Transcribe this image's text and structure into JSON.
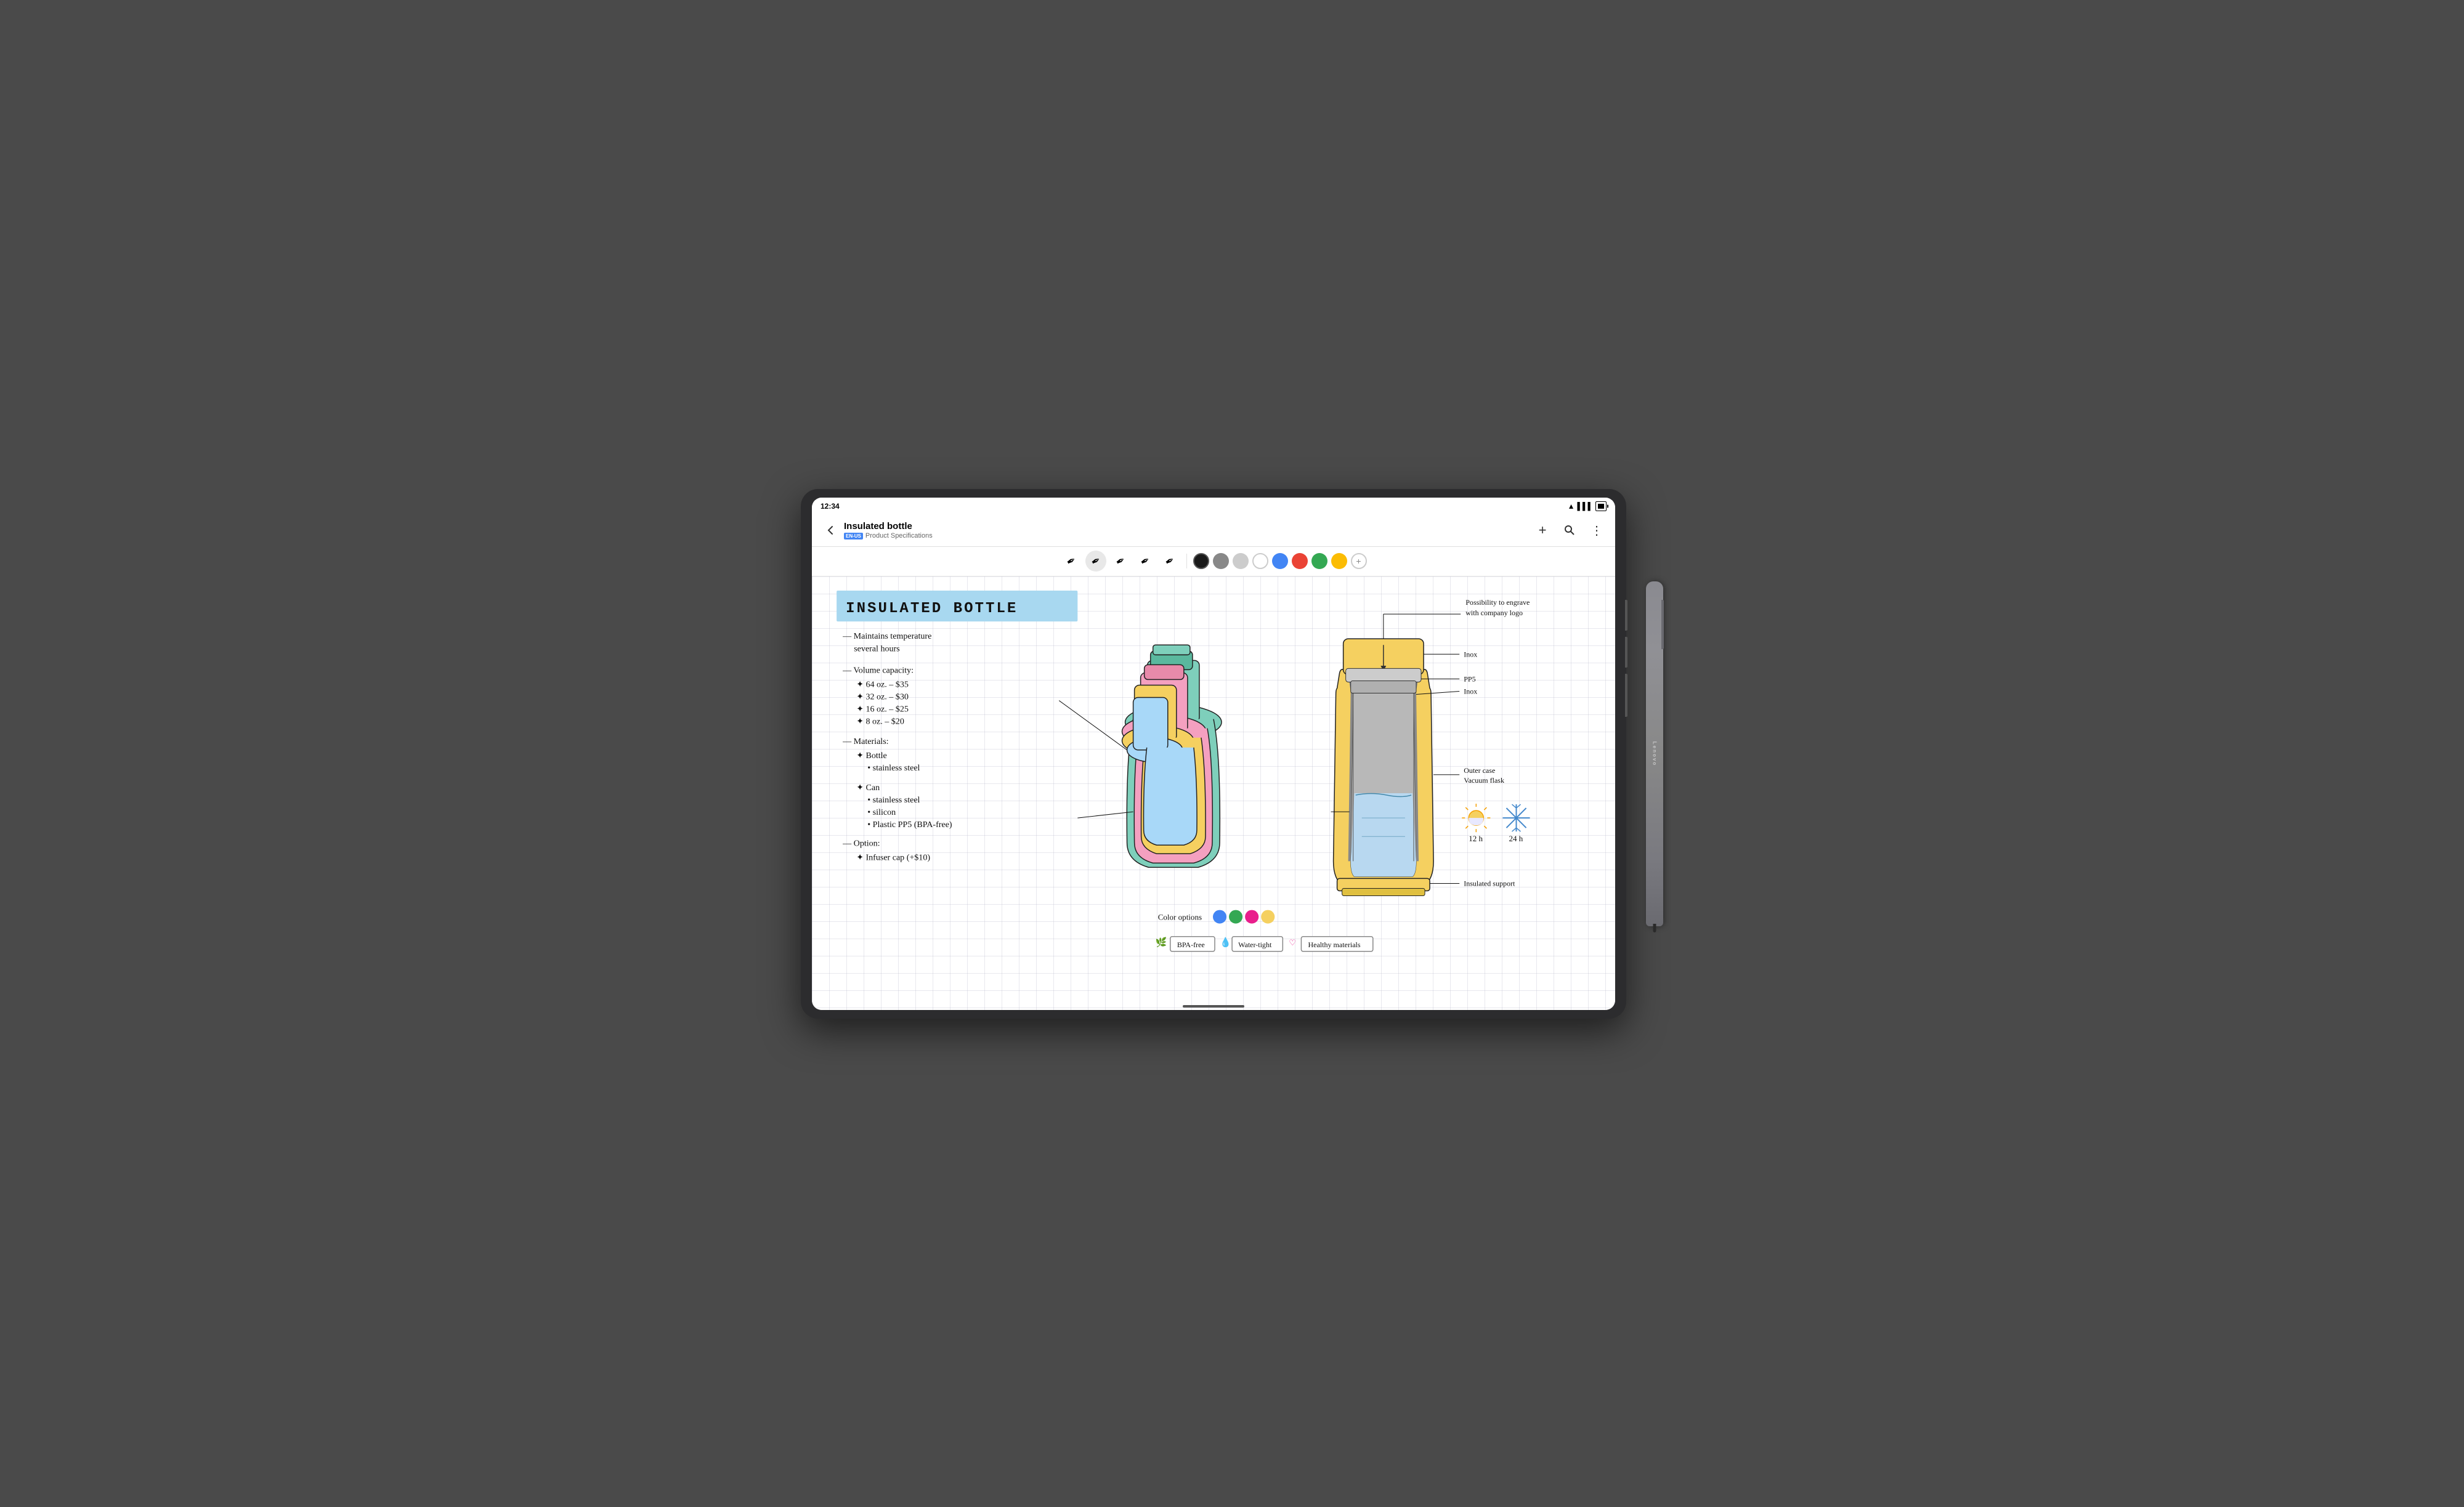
{
  "device": {
    "time": "12:34",
    "brand": "Lenovo"
  },
  "app_bar": {
    "title": "Insulated bottle",
    "lang_badge": "EN-US",
    "subtitle": "Product Specifications",
    "back_label": "←",
    "add_label": "+",
    "search_label": "🔍",
    "more_label": "⋮"
  },
  "toolbar": {
    "pen_tools": [
      "✒",
      "✒",
      "✒",
      "✒",
      "✒"
    ],
    "colors": [
      {
        "color": "#1a1a1a",
        "selected": true
      },
      {
        "color": "#888888",
        "selected": false
      },
      {
        "color": "#cccccc",
        "selected": false
      },
      {
        "color": "#ffffff",
        "selected": false
      },
      {
        "color": "#4285f4",
        "selected": false
      },
      {
        "color": "#ea4335",
        "selected": false
      },
      {
        "color": "#34a853",
        "selected": false
      },
      {
        "color": "#fbbc04",
        "selected": false
      }
    ],
    "add_color": "+"
  },
  "note": {
    "title": "INSULATED BOTTLE",
    "lines": [
      "— Maintains temperature",
      "   several hours",
      "",
      "— Volume capacity:",
      "  ✦ 64 oz. – $35",
      "  ✦ 32 oz. – $30",
      "  ✦ 16 oz. – $25",
      "  ✦ 8 oz. – $20",
      "",
      "— Materials:",
      "  ✦ Bottle",
      "    • stainless steel",
      "",
      "  ✦ Can",
      "    • stainless steel",
      "    • silicon",
      "    • Plastic PP5 (BPA-free)",
      "",
      "— Option:",
      "  ✦ Infuser cap (+$10)"
    ]
  },
  "diagram": {
    "labels": [
      "Possibility to engrave",
      "with company logo",
      "Inox",
      "PP5",
      "Inox",
      "Outer case",
      "Vacuum flask",
      "Insulated support"
    ],
    "temp_labels": [
      "12 h",
      "24 h"
    ]
  },
  "color_options": {
    "label": "Color options",
    "colors": [
      "#4285f4",
      "#34a853",
      "#e91e8c",
      "#fbbc04"
    ]
  },
  "features": [
    {
      "icon": "🌿",
      "label": "BPA-free"
    },
    {
      "icon": "💧",
      "label": "Water-tight"
    },
    {
      "icon": "♡",
      "label": "Healthy materials"
    }
  ]
}
